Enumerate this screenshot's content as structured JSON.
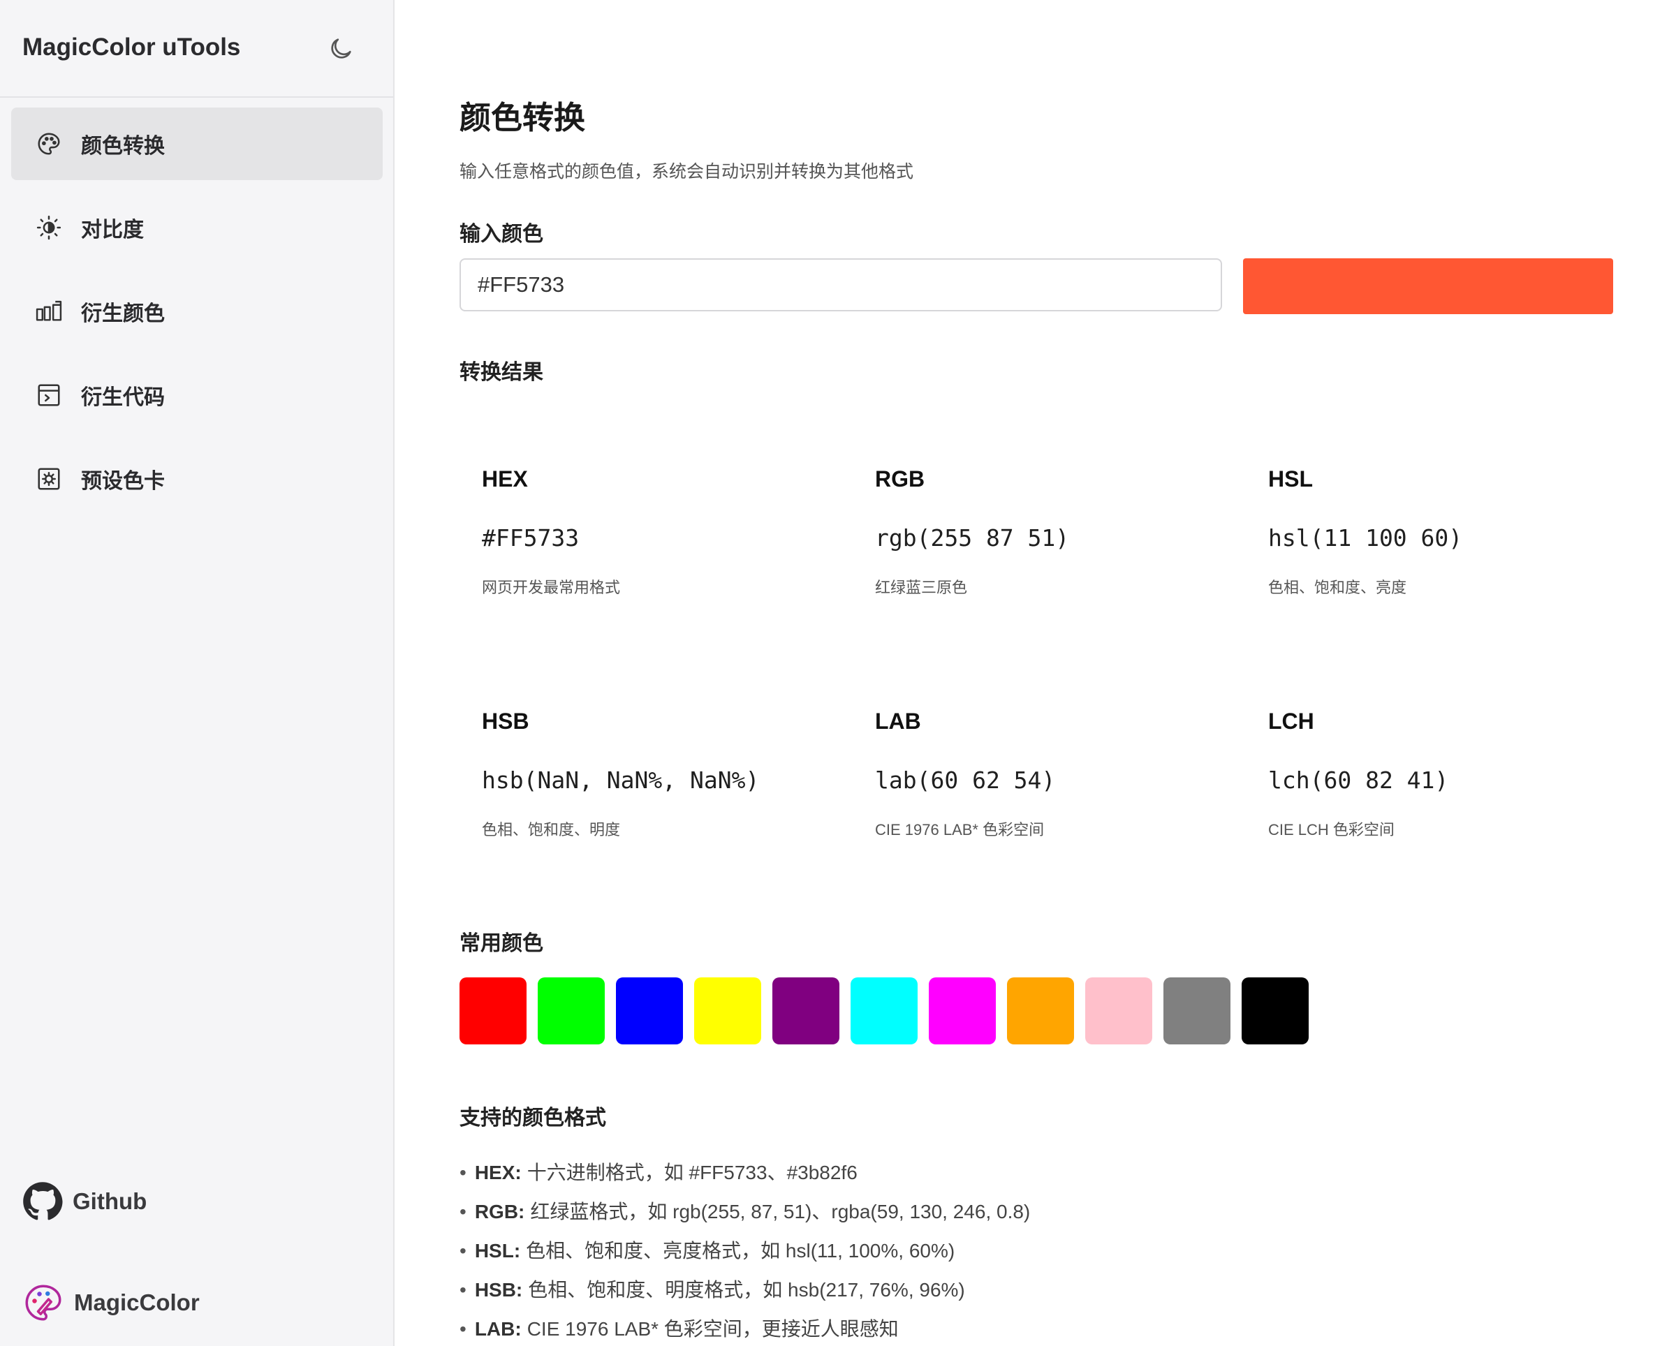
{
  "sidebar": {
    "brand": "MagicColor uTools",
    "nav": [
      {
        "label": "颜色转换",
        "icon": "palette-icon",
        "active": true
      },
      {
        "label": "对比度",
        "icon": "contrast-icon",
        "active": false
      },
      {
        "label": "衍生颜色",
        "icon": "derive-icon",
        "active": false
      },
      {
        "label": "衍生代码",
        "icon": "code-icon",
        "active": false
      },
      {
        "label": "预设色卡",
        "icon": "preset-icon",
        "active": false
      }
    ],
    "footer": {
      "github": "Github",
      "magiccolor": "MagicColor"
    }
  },
  "main": {
    "title": "颜色转换",
    "description": "输入任意格式的颜色值，系统会自动识别并转换为其他格式",
    "input_label": "输入颜色",
    "input_value": "#FF5733",
    "preview_color": "#FF5733",
    "results_title": "转换结果",
    "results": [
      {
        "format": "HEX",
        "value": "#FF5733",
        "hint": "网页开发最常用格式"
      },
      {
        "format": "RGB",
        "value": "rgb(255 87 51)",
        "hint": "红绿蓝三原色"
      },
      {
        "format": "HSL",
        "value": "hsl(11 100 60)",
        "hint": "色相、饱和度、亮度"
      },
      {
        "format": "HSB",
        "value": "hsb(NaN, NaN%, NaN%)",
        "hint": "色相、饱和度、明度"
      },
      {
        "format": "LAB",
        "value": "lab(60 62 54)",
        "hint": "CIE 1976 LAB* 色彩空间"
      },
      {
        "format": "LCH",
        "value": "lch(60 82 41)",
        "hint": "CIE LCH 色彩空间"
      }
    ],
    "common_title": "常用颜色",
    "common_colors": [
      "#FF0000",
      "#00FF00",
      "#0000FF",
      "#FFFF00",
      "#800080",
      "#00FFFF",
      "#FF00FF",
      "#FFA500",
      "#FFC0CB",
      "#808080",
      "#000000"
    ],
    "formats_title": "支持的颜色格式",
    "formats": [
      {
        "key": "HEX:",
        "text": "十六进制格式，如 #FF5733、#3b82f6"
      },
      {
        "key": "RGB:",
        "text": "红绿蓝格式，如 rgb(255, 87, 51)、rgba(59, 130, 246, 0.8)"
      },
      {
        "key": "HSL:",
        "text": "色相、饱和度、亮度格式，如 hsl(11, 100%, 60%)"
      },
      {
        "key": "HSB:",
        "text": "色相、饱和度、明度格式，如 hsb(217, 76%, 96%)"
      },
      {
        "key": "LAB:",
        "text": "CIE 1976 LAB* 色彩空间，更接近人眼感知"
      }
    ]
  }
}
